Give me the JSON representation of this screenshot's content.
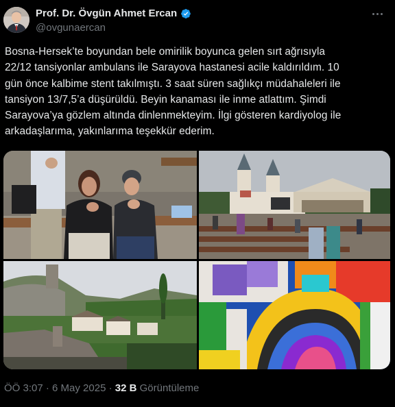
{
  "author": {
    "name": "Prof. Dr. Övgün Ahmet Ercan",
    "handle": "@ovgunaercan",
    "verified_color": "#1d9bf0"
  },
  "tweet": {
    "text": "Bosna-Hersek’te boyundan bele omirilik boyunca gelen sırt ağrısıyla\n22/12 tansiyonlar ambulans ile Sarayova hastanesi acile kaldırıldım. 10\ngün  önce kalbime stent takılmıştı. 3 saat süren sağlıkçı müdahaleleri ile\ntansiyon 13/7,5’a düşürüldü. Beyin kanaması ile inme atlattım. Şimdi\nSarayova’ya gözlem altında dinlenmekteyim. İlgi gösteren kardiyolog ile\narkadaşlarıma, yakınlarıma teşekkür ederim."
  },
  "media": {
    "photos": [
      {
        "icon": "photo-people-praying"
      },
      {
        "icon": "photo-church-square"
      },
      {
        "icon": "photo-old-town-hillside"
      },
      {
        "icon": "photo-colorful-painting"
      }
    ]
  },
  "meta": {
    "time": "ÖÖ 3:07",
    "sep1": " · ",
    "date": "6 May 2025",
    "sep2": " · ",
    "views_count": "32 B",
    "views_label": " Görüntüleme"
  },
  "icons": {
    "more": "more-options-icon",
    "verified": "verified-badge-icon"
  }
}
